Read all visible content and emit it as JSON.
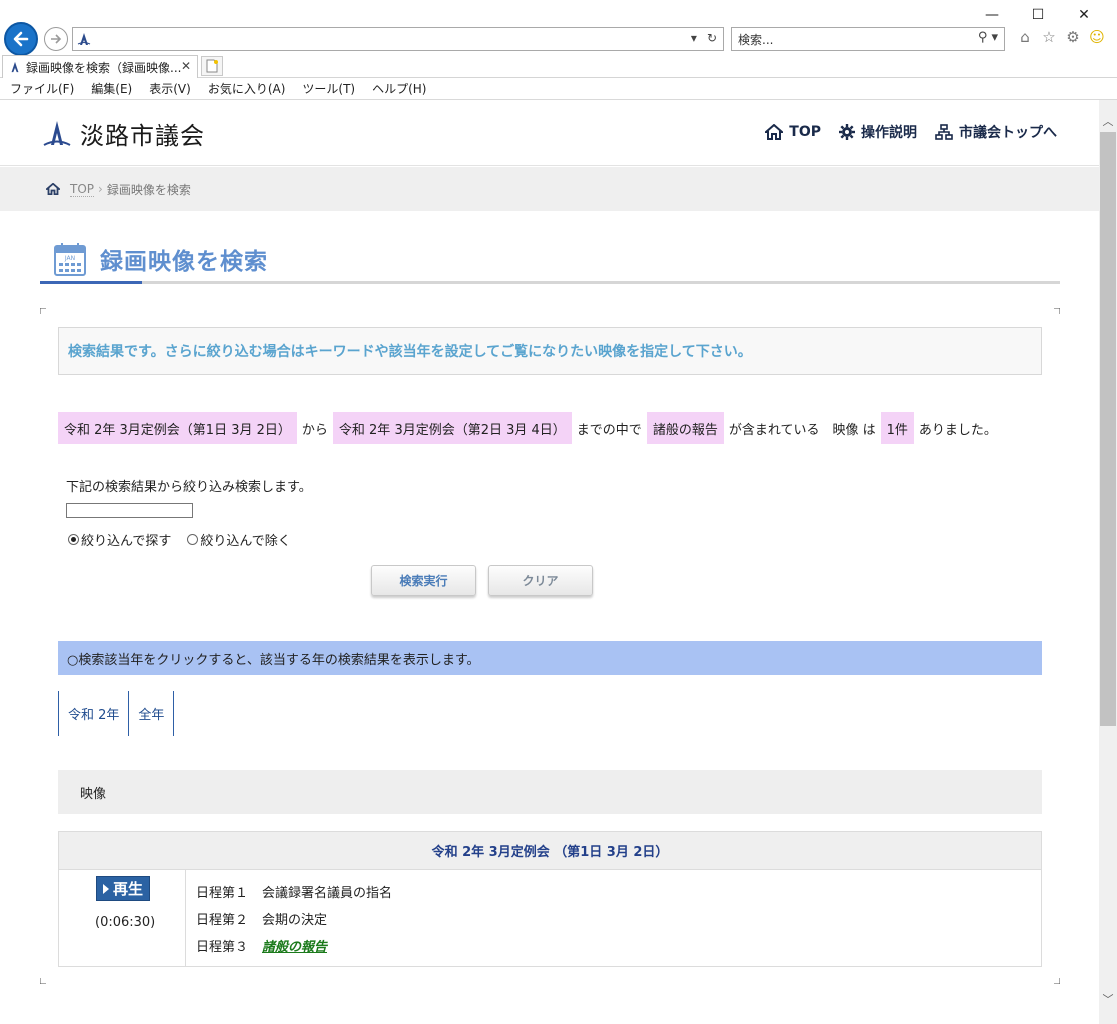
{
  "browser": {
    "address": "",
    "search_placeholder": "検索...",
    "tab_title": "録画映像を検索（録画映像...",
    "menu": [
      "ファイル(F)",
      "編集(E)",
      "表示(V)",
      "お気に入り(A)",
      "ツール(T)",
      "ヘルプ(H)"
    ]
  },
  "site": {
    "logo_text": "淡路市議会",
    "nav": {
      "top": "TOP",
      "howto": "操作説明",
      "council_top": "市議会トップへ"
    }
  },
  "breadcrumb": {
    "top": "TOP",
    "sep": "›",
    "current": "録画映像を検索"
  },
  "page": {
    "title": "録画映像を検索",
    "calendar_label": "JAN"
  },
  "notice": "検索結果です。さらに絞り込む場合はキーワードや該当年を設定してご覧になりたい映像を指定して下さい。",
  "result": {
    "from_session": "令和 2年 3月定例会（第1日 3月 2日）",
    "from_word": "から",
    "to_session": "令和 2年 3月定例会（第2日 3月 4日）",
    "to_word": "までの中で",
    "keyword": "諸般の報告",
    "contains": "が含まれている　映像 は",
    "count": "1件",
    "ending": "ありました。"
  },
  "refine": {
    "label": "下記の検索結果から絞り込み検索します。",
    "input_value": "",
    "option_include": "絞り込んで探す",
    "option_exclude": "絞り込んで除く",
    "search_button": "検索実行",
    "clear_button": "クリア"
  },
  "year_notice": "○検索該当年をクリックすると、該当する年の検索結果を表示します。",
  "year_tabs": [
    "令和 2年",
    "全年"
  ],
  "video_header": "映像",
  "session": {
    "title": "令和 2年 3月定例会 （第1日 3月 2日）",
    "play_label": "再生",
    "duration": "(0:06:30)",
    "items": [
      {
        "no": "日程第１",
        "title": "会議録署名議員の指名",
        "hit": false
      },
      {
        "no": "日程第２",
        "title": "会期の決定",
        "hit": false
      },
      {
        "no": "日程第３",
        "title": "諸般の報告",
        "hit": true
      }
    ]
  },
  "colors": {
    "accent_blue": "#3c67b6",
    "title_blue": "#5f8fcf",
    "highlight_pink": "#f4d3f7",
    "year_bar": "#a9c2f3",
    "hit_green": "#1b7a1b"
  }
}
